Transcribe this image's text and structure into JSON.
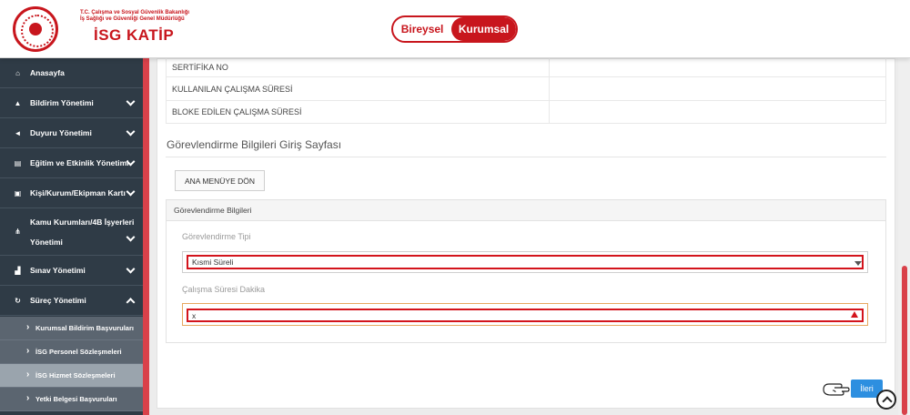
{
  "header": {
    "ministry_line1": "T.C. Çalışma ve Sosyal Güvenlik Bakanlığı",
    "ministry_line2": "İş Sağlığı ve Güvenliği Genel Müdürlüğü",
    "brand": "İSG KATİP",
    "toggle": {
      "individual": "Bireysel",
      "corporate": "Kurumsal",
      "active": "corporate"
    },
    "accent_color": "#c8161d"
  },
  "sidebar": {
    "items": [
      {
        "label": "Anasayfa",
        "icon": "home-icon",
        "chevron": "none"
      },
      {
        "label": "Bildirim Yönetimi",
        "icon": "bell-icon",
        "chevron": "down"
      },
      {
        "label": "Duyuru Yönetimi",
        "icon": "megaphone-icon",
        "chevron": "down"
      },
      {
        "label": "Eğitim ve Etkinlik Yönetimi",
        "icon": "board-icon",
        "chevron": "down"
      },
      {
        "label": "Kişi/Kurum/Ekipman Kartı",
        "icon": "id-card-icon",
        "chevron": "down"
      },
      {
        "label": "Kamu Kurumları/4B İşyerleri",
        "label2": "Yönetimi",
        "icon": "sitemap-icon",
        "chevron": "down"
      },
      {
        "label": "Sınav Yönetimi",
        "icon": "exam-icon",
        "chevron": "down"
      },
      {
        "label": "Süreç Yönetimi",
        "icon": "refresh-icon",
        "chevron": "up"
      }
    ],
    "sub_items": [
      {
        "label": "Kurumsal Bildirim Başvuruları"
      },
      {
        "label": "İSG Personel Sözleşmeleri"
      },
      {
        "label": "İSG Hizmet Sözleşmeleri",
        "selected": true
      },
      {
        "label": "Yetki Belgesi Başvuruları"
      }
    ]
  },
  "info_rows": [
    {
      "label": "SERTİFİKA NO"
    },
    {
      "label": "KULLANILAN ÇALIŞMA SÜRESİ"
    },
    {
      "label": "BLOKE EDİLEN ÇALIŞMA SÜRESİ"
    }
  ],
  "main": {
    "section_title": "Görevlendirme Bilgileri Giriş Sayfası",
    "back_button": "ANA MENÜYE DÖN",
    "panel_title": "Görevlendirme Bilgileri",
    "assignment_type_label": "Görevlendirme Tipi",
    "assignment_type_value": "Kısmi Süreli",
    "work_minutes_label": "Çalışma Süresi Dakika",
    "work_minutes_value": "x",
    "next_button": "İleri"
  }
}
